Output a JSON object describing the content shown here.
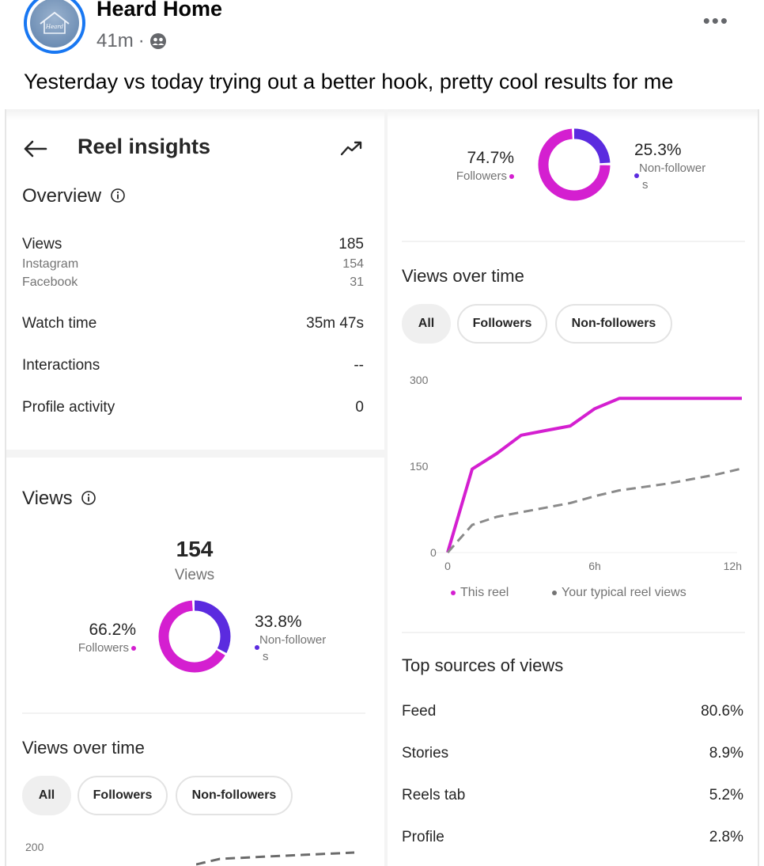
{
  "post": {
    "page_name": "Heard Home",
    "time": "41m",
    "separator": "·",
    "text": "Yesterday vs today trying out a better hook, pretty cool results for me",
    "more": "•••",
    "avatar_icon": "house-logo-icon",
    "audience_icon": "friends-icon"
  },
  "insights": {
    "header_title": "Reel insights",
    "back_icon": "arrow-left-icon",
    "trend_icon": "trending-up-icon",
    "overview": {
      "title": "Overview",
      "info_icon": "info-icon",
      "rows": [
        {
          "label": "Views",
          "value": "185"
        },
        {
          "label": "Instagram",
          "value": "154"
        },
        {
          "label": "Facebook",
          "value": "31"
        },
        {
          "label": "Watch time",
          "value": "35m 47s"
        },
        {
          "label": "Interactions",
          "value": "--"
        },
        {
          "label": "Profile activity",
          "value": "0"
        }
      ]
    },
    "views": {
      "title": "Views",
      "total": "154",
      "total_label": "Views",
      "followers_pct": "66.2%",
      "followers_label": "Followers",
      "non_followers_pct": "33.8%",
      "non_followers_label_1": "Non-follower",
      "non_followers_label_2": "s",
      "donut": {
        "followers": 66.2,
        "non_followers": 33.8
      }
    },
    "views_over_time_left": {
      "title": "Views over time",
      "filters": [
        "All",
        "Followers",
        "Non-followers"
      ],
      "y_top_tick": "200"
    },
    "right_donut": {
      "followers_pct": "74.7%",
      "followers_label": "Followers",
      "non_followers_pct": "25.3%",
      "non_followers_label_1": "Non-follower",
      "non_followers_label_2": "s",
      "donut": {
        "followers": 74.7,
        "non_followers": 25.3
      }
    },
    "views_over_time_right": {
      "title": "Views over time",
      "filters": [
        "All",
        "Followers",
        "Non-followers"
      ],
      "legend_this": "This reel",
      "legend_typical": "Your typical reel views"
    },
    "top_sources": {
      "title": "Top sources of views",
      "rows": [
        {
          "label": "Feed",
          "value": "80.6%"
        },
        {
          "label": "Stories",
          "value": "8.9%"
        },
        {
          "label": "Reels tab",
          "value": "5.2%"
        },
        {
          "label": "Profile",
          "value": "2.8%"
        }
      ]
    }
  },
  "colors": {
    "followers": "#d41fd0",
    "non_followers": "#5b2bdf",
    "typical_line": "#8a8a8a",
    "facebook_blue": "#1877f2"
  },
  "chart_data": {
    "type": "line",
    "x_ticks": [
      "0",
      "6h",
      "12h"
    ],
    "y_ticks": [
      "0",
      "150",
      "300"
    ],
    "ylim": [
      0,
      300
    ],
    "x": [
      0,
      1,
      2,
      3,
      4,
      5,
      6,
      7,
      8,
      9,
      10,
      11,
      12
    ],
    "series": [
      {
        "name": "This reel",
        "style": "solid",
        "values": [
          0,
          145,
          172,
          204,
          212,
          220,
          250,
          268,
          268,
          268,
          268,
          268,
          268
        ]
      },
      {
        "name": "Your typical reel views",
        "style": "dashed",
        "values": [
          0,
          48,
          62,
          70,
          78,
          86,
          98,
          108,
          114,
          120,
          128,
          136,
          146
        ]
      }
    ]
  }
}
